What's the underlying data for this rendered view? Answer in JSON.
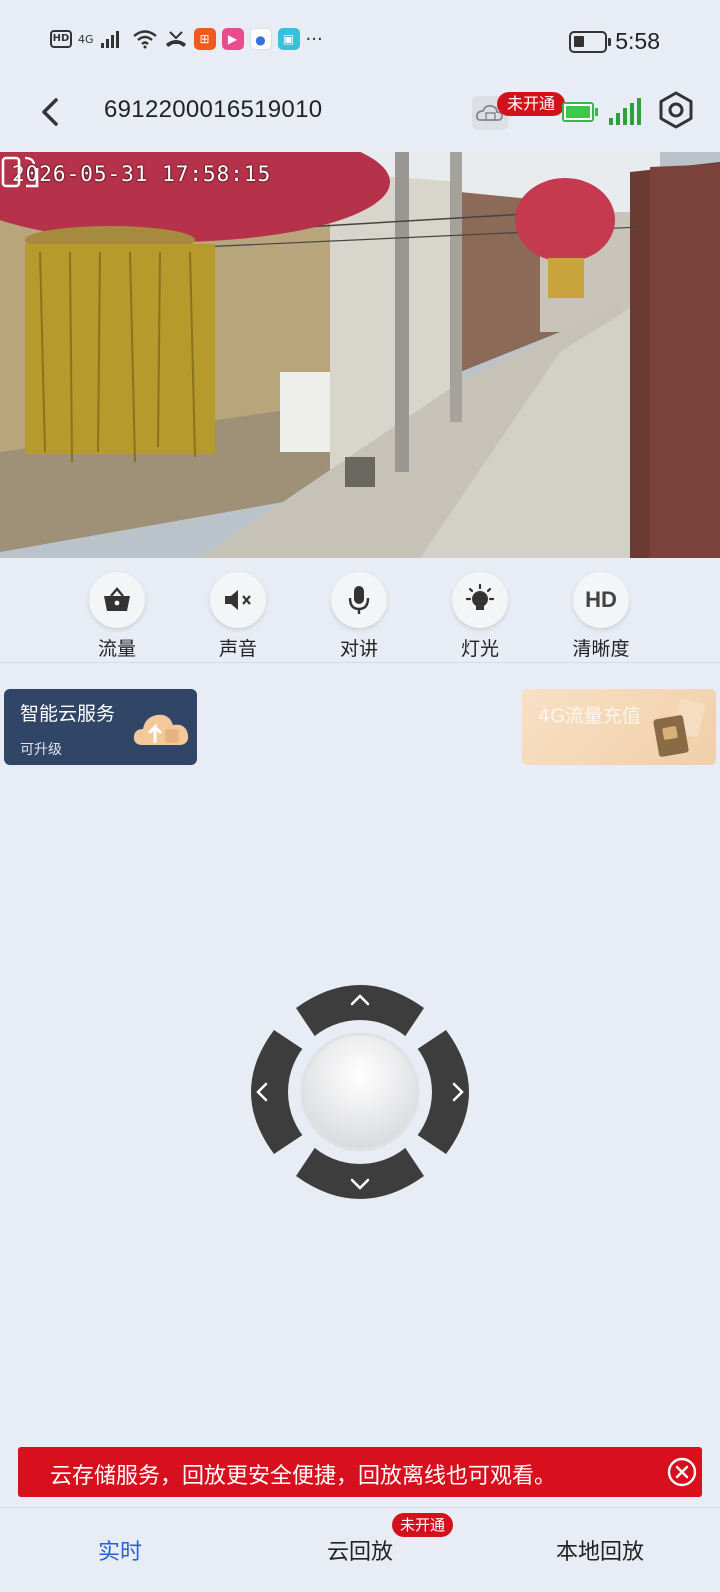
{
  "status_bar": {
    "hd": "HD",
    "network": "4G",
    "time": "5:58",
    "more": "···",
    "icons": [
      "hd-icon",
      "signal-icon",
      "wifi-icon",
      "missed-call-icon",
      "app-icon-1",
      "app-icon-2",
      "app-icon-3",
      "app-icon-4",
      "battery-icon"
    ]
  },
  "header": {
    "device_id": "6912200016519010",
    "cloud_badge": "未开通",
    "icons": [
      "back-arrow-icon",
      "cloud-icon",
      "battery-icon",
      "signal-icon",
      "settings-icon"
    ]
  },
  "video": {
    "timestamp": "2026-05-31 17:58:15"
  },
  "controls": [
    {
      "label": "流量",
      "icon": "basket-icon"
    },
    {
      "label": "声音",
      "icon": "speaker-mute-icon"
    },
    {
      "label": "对讲",
      "icon": "microphone-icon"
    },
    {
      "label": "灯光",
      "icon": "light-icon"
    },
    {
      "label": "清晰度",
      "icon": "hd-icon",
      "icon_text": "HD"
    }
  ],
  "cards": {
    "cloud_service": {
      "title": "智能云服务",
      "subtitle": "可升级"
    },
    "data_recharge": {
      "title": "4G流量充值"
    }
  },
  "banner": {
    "text": "云存储服务，回放更安全便捷，回放离线也可观看。"
  },
  "bottom_nav": {
    "tabs": [
      "实时",
      "云回放",
      "本地回放"
    ],
    "badge": "未开通"
  },
  "colors": {
    "background": "#e7ecf5",
    "accent_blue": "#2a5fd6",
    "banner_red": "#d8101d",
    "cloud_card": "#314567"
  }
}
